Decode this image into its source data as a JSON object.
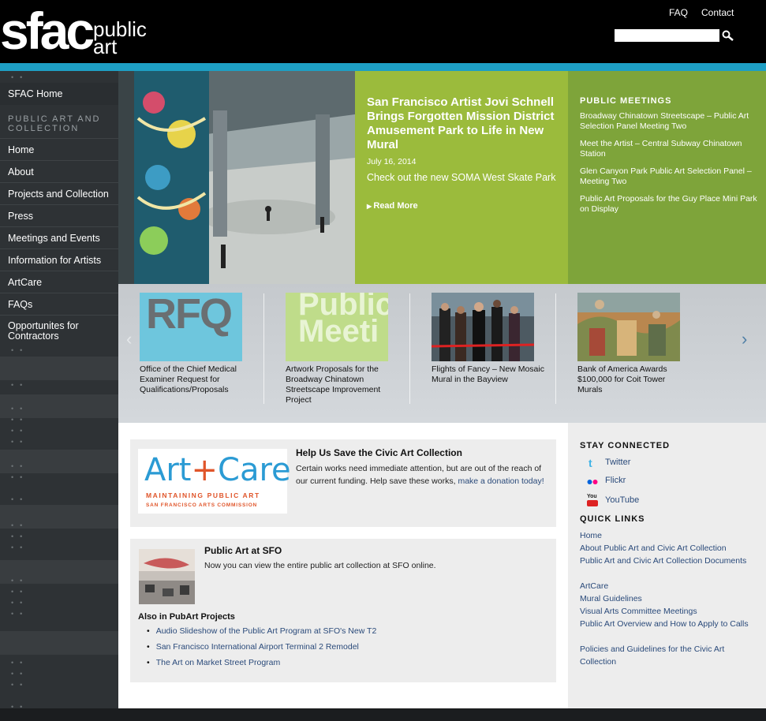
{
  "header": {
    "logo_main": "sfac",
    "logo_sub_1": "public",
    "logo_sub_2": "art",
    "util_links": [
      "FAQ",
      "Contact"
    ],
    "search_value": ""
  },
  "sidebar": {
    "home_link": "SFAC Home",
    "section_title": "PUBLIC ART AND COLLECTION",
    "items": [
      "Home",
      "About",
      "Projects and Collection",
      "Press",
      "Meetings and Events",
      "Information for Artists",
      "ArtCare",
      "FAQs",
      "Opportunites for Contractors"
    ]
  },
  "hero": {
    "title": "San Francisco Artist Jovi Schnell Brings Forgotten Mission District Amusement Park to Life in New Mural",
    "date": "July 16, 2014",
    "description": "Check out the new SOMA West Skate Park",
    "read_more": "Read More"
  },
  "meetings": {
    "title": "PUBLIC MEETINGS",
    "links": [
      "Broadway Chinatown Streetscape – Public Art Selection Panel Meeting Two",
      "Meet the Artist – Central Subway Chinatown Station",
      "Glen Canyon Park Public Art Selection Panel – Meeting Two",
      "Public Art Proposals for the Guy Place Mini Park on Display"
    ]
  },
  "carousel": {
    "items": [
      {
        "thumb_text": "RFQ",
        "caption": "Office of the Chief Medical Examiner Request for Qualifications/Proposals"
      },
      {
        "thumb_text": "Public Meeti",
        "caption": "Artwork Proposals for the Broadway Chinatown Streetscape Improvement Project"
      },
      {
        "thumb_text": "",
        "caption": "Flights of Fancy – New Mosaic Mural in the Bayview"
      },
      {
        "thumb_text": "",
        "caption": "Bank of America Awards $100,000 for Coit Tower Murals"
      }
    ],
    "arrow_left": "‹",
    "arrow_right": "›"
  },
  "artcare": {
    "logo_text_art": "Art",
    "logo_text_plus": "+",
    "logo_text_care": "Care",
    "logo_sub1": "MAINTAINING PUBLIC ART",
    "logo_sub2": "SAN FRANCISCO ARTS COMMISSION",
    "heading": "Help Us Save the Civic Art Collection",
    "text": "Certain works need immediate attention, but are out of the reach of our current funding. Help save these works,",
    "link": "make a donation today!"
  },
  "sfo": {
    "heading": "Public Art at SFO",
    "text": "Now you can view the entire public art collection at SFO online.",
    "also_heading": "Also in PubArt Projects",
    "also_links": [
      "Audio Slideshow of the Public Art Program at SFO's New T2",
      "San Francisco International Airport Terminal 2 Remodel",
      "The Art on Market Street Program"
    ]
  },
  "right": {
    "stay_heading": "STAY CONNECTED",
    "social": [
      "Twitter",
      "Flickr",
      "YouTube"
    ],
    "youtube_icon_text": "You",
    "quick_heading": "QUICK LINKS",
    "quick_links": [
      "Home",
      "About Public Art and Civic Art Collection",
      "Public Art and Civic Art Collection Documents",
      "ArtCare",
      "Mural Guidelines",
      "Visual Arts Committee Meetings",
      "Public Art Overview and How to Apply to Calls",
      "Policies and Guidelines for the Civic Art Collection"
    ]
  },
  "colors": {
    "accent_teal": "#1e9fc4",
    "hero_green": "#9bbb3c",
    "meetings_green": "#7ea43a",
    "link_blue": "#2a4a7a",
    "artcare_blue": "#2b9bd4",
    "artcare_orange": "#e0552a"
  }
}
